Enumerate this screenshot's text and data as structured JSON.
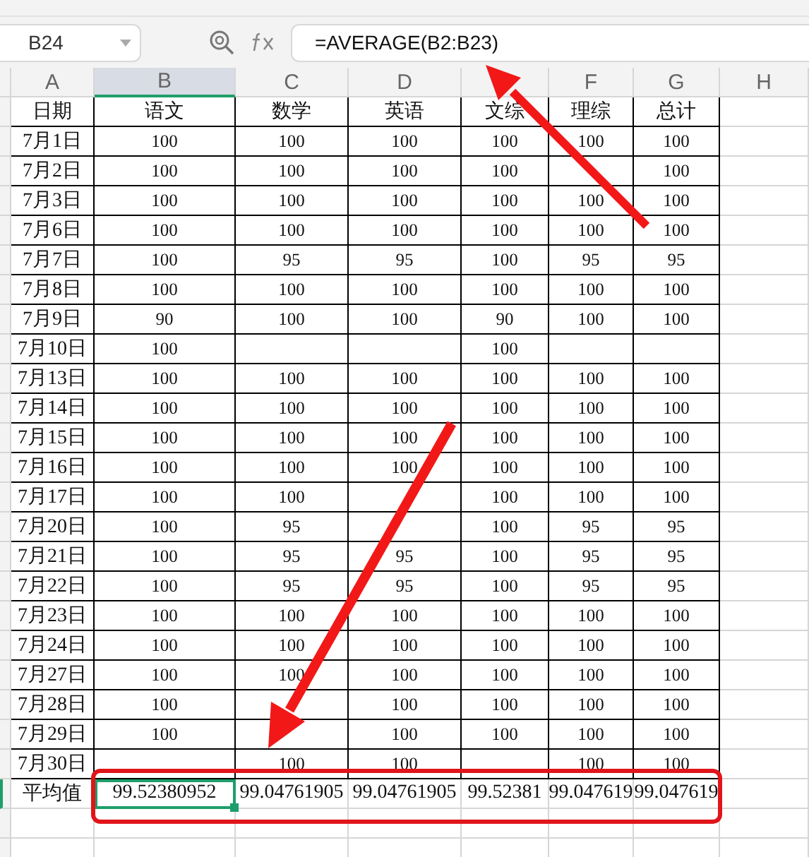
{
  "name_box": {
    "value": "B24"
  },
  "formula_bar": {
    "value": "=AVERAGE(B2:B23)"
  },
  "columns": [
    {
      "label": "A",
      "selected": false
    },
    {
      "label": "B",
      "selected": true
    },
    {
      "label": "C",
      "selected": false
    },
    {
      "label": "D",
      "selected": false
    },
    {
      "selected": false
    },
    {
      "label": "F",
      "selected": false
    },
    {
      "label": "G",
      "selected": false
    },
    {
      "label": "H",
      "selected": false
    }
  ],
  "header_row": [
    "日期",
    "语文",
    "数学",
    "英语",
    "文综",
    "理综",
    "总计"
  ],
  "rows": [
    {
      "date": "7月1日",
      "cells": [
        "100",
        "100",
        "100",
        "100",
        "100",
        "100"
      ]
    },
    {
      "date": "7月2日",
      "cells": [
        "100",
        "100",
        "100",
        "100",
        "",
        "100"
      ]
    },
    {
      "date": "7月3日",
      "cells": [
        "100",
        "100",
        "100",
        "100",
        "100",
        "100"
      ]
    },
    {
      "date": "7月6日",
      "cells": [
        "100",
        "100",
        "100",
        "100",
        "100",
        "100"
      ]
    },
    {
      "date": "7月7日",
      "cells": [
        "100",
        "95",
        "95",
        "100",
        "95",
        "95"
      ]
    },
    {
      "date": "7月8日",
      "cells": [
        "100",
        "100",
        "100",
        "100",
        "100",
        "100"
      ]
    },
    {
      "date": "7月9日",
      "cells": [
        "90",
        "100",
        "100",
        "90",
        "100",
        "100"
      ]
    },
    {
      "date": "7月10日",
      "cells": [
        "100",
        "",
        "",
        "100",
        "",
        ""
      ]
    },
    {
      "date": "7月13日",
      "cells": [
        "100",
        "100",
        "100",
        "100",
        "100",
        "100"
      ]
    },
    {
      "date": "7月14日",
      "cells": [
        "100",
        "100",
        "100",
        "100",
        "100",
        "100"
      ]
    },
    {
      "date": "7月15日",
      "cells": [
        "100",
        "100",
        "100",
        "100",
        "100",
        "100"
      ]
    },
    {
      "date": "7月16日",
      "cells": [
        "100",
        "100",
        "100",
        "100",
        "100",
        "100"
      ]
    },
    {
      "date": "7月17日",
      "cells": [
        "100",
        "100",
        "",
        "100",
        "100",
        "100"
      ]
    },
    {
      "date": "7月20日",
      "cells": [
        "100",
        "95",
        "",
        "100",
        "95",
        "95"
      ]
    },
    {
      "date": "7月21日",
      "cells": [
        "100",
        "95",
        "95",
        "100",
        "95",
        "95"
      ]
    },
    {
      "date": "7月22日",
      "cells": [
        "100",
        "95",
        "95",
        "100",
        "95",
        "95"
      ]
    },
    {
      "date": "7月23日",
      "cells": [
        "100",
        "100",
        "100",
        "100",
        "100",
        "100"
      ]
    },
    {
      "date": "7月24日",
      "cells": [
        "100",
        "100",
        "100",
        "100",
        "100",
        "100"
      ]
    },
    {
      "date": "7月27日",
      "cells": [
        "100",
        "100",
        "100",
        "100",
        "100",
        "100"
      ]
    },
    {
      "date": "7月28日",
      "cells": [
        "100",
        "",
        "100",
        "100",
        "100",
        "100"
      ]
    },
    {
      "date": "7月29日",
      "cells": [
        "100",
        "",
        "100",
        "100",
        "100",
        "100"
      ]
    },
    {
      "date": "7月30日",
      "cells": [
        "",
        "100",
        "100",
        "",
        "100",
        "100"
      ]
    }
  ],
  "average_row": {
    "label": "平均值",
    "cells": [
      {
        "value": "99.52380952",
        "selected": true
      },
      {
        "value": "99.04761905",
        "selected": false
      },
      {
        "value": "99.04761905",
        "selected": false
      },
      {
        "value": "99.52381",
        "selected": false
      },
      {
        "value": "99.047619",
        "selected": false
      },
      {
        "value": "99.047619",
        "selected": false
      }
    ]
  }
}
